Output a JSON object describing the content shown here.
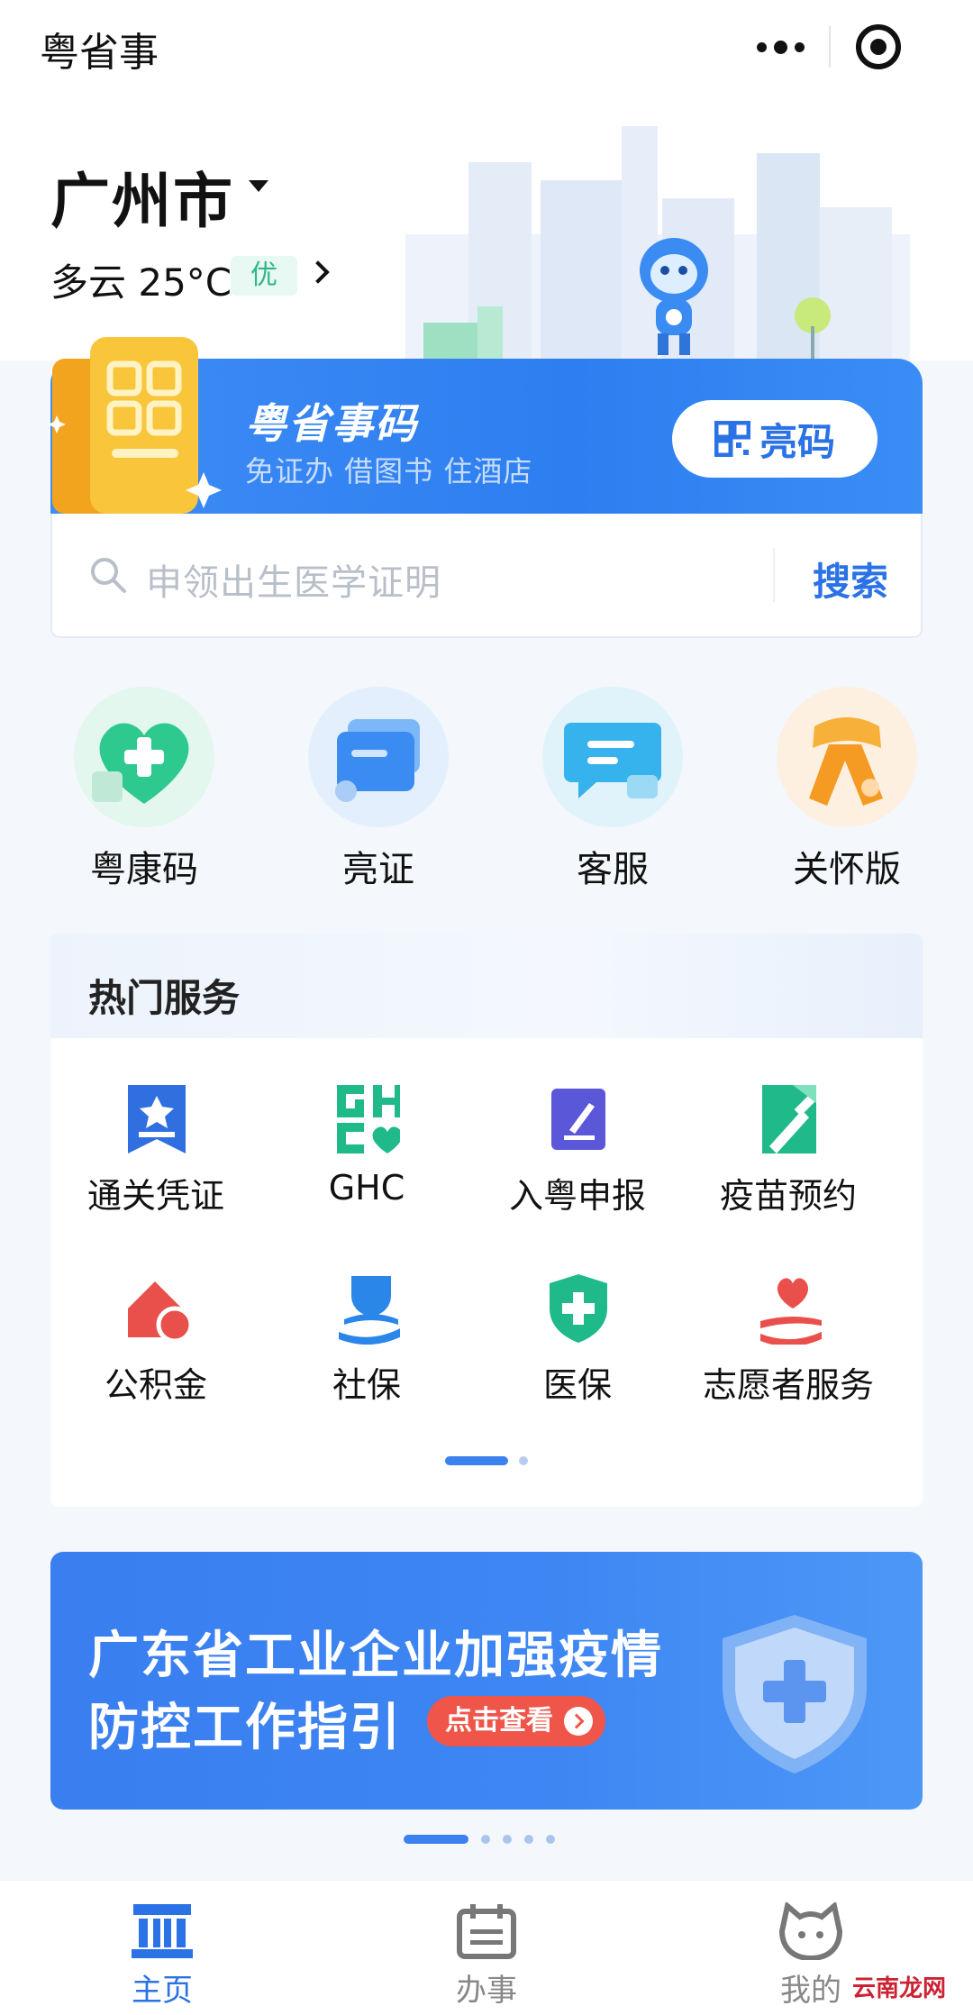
{
  "topbar": {
    "title": "粤省事",
    "more_icon": "more-dots-icon",
    "close_icon": "target-close-icon"
  },
  "hero": {
    "city": "广州市",
    "weather": "多云 25°C",
    "aqi": "优"
  },
  "code_card": {
    "title": "粤省事码",
    "subtitle": "免证办 借图书 住酒店",
    "button": "亮码"
  },
  "search": {
    "placeholder": "申领出生医学证明",
    "button": "搜索"
  },
  "quick": [
    {
      "label": "粤康码",
      "icon": "health-heart-icon"
    },
    {
      "label": "亮证",
      "icon": "cards-icon"
    },
    {
      "label": "客服",
      "icon": "chat-bubble-icon"
    },
    {
      "label": "关怀版",
      "icon": "scarf-icon"
    }
  ],
  "hot": {
    "title": "热门服务",
    "items": [
      {
        "label": "通关凭证",
        "icon": "badge-star-icon",
        "color": "#2f6fe0"
      },
      {
        "label": "GHC",
        "icon": "ghc-heart-icon",
        "color": "#1fb98a"
      },
      {
        "label": "入粤申报",
        "icon": "pen-square-icon",
        "color": "#5b57d9"
      },
      {
        "label": "疫苗预约",
        "icon": "syringe-icon",
        "color": "#1fb98a"
      },
      {
        "label": "公积金",
        "icon": "house-coin-icon",
        "color": "#e9504b"
      },
      {
        "label": "社保",
        "icon": "person-hand-icon",
        "color": "#2a86e8"
      },
      {
        "label": "医保",
        "icon": "shield-cross-icon",
        "color": "#1fb98a"
      },
      {
        "label": "志愿者服务",
        "icon": "heart-hand-icon",
        "color": "#e9504b"
      }
    ]
  },
  "banner": {
    "line1": "广东省工业企业加强疫情",
    "line2": "防控工作指引",
    "cta": "点击查看"
  },
  "tabs": [
    {
      "label": "主页",
      "icon": "home-building-icon",
      "active": true
    },
    {
      "label": "办事",
      "icon": "calendar-icon",
      "active": false
    },
    {
      "label": "我的",
      "icon": "mascot-face-icon",
      "active": false
    }
  ],
  "watermark": "云南龙网",
  "colors": {
    "accent": "#2a72e6",
    "green": "#1fb98a",
    "red": "#e9504b"
  }
}
